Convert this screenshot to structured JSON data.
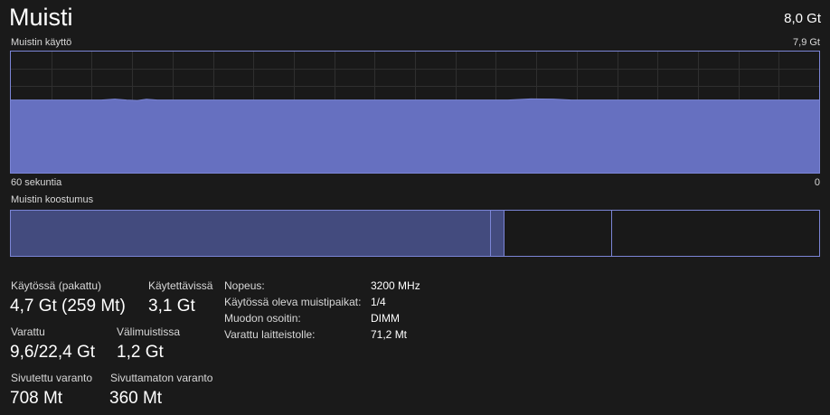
{
  "header": {
    "title": "Muisti",
    "total": "8,0 Gt"
  },
  "usage_graph": {
    "label": "Muistin käyttö",
    "max_label": "7,9 Gt",
    "time_label": "60 sekuntia",
    "zero_label": "0",
    "usage_fraction": 0.6,
    "line_color": "#7b85d6",
    "fill_color": "#6670c0",
    "grid_color": "#2f2f2f"
  },
  "composition": {
    "label": "Muistin koostumus",
    "fill_color": "#434b7e",
    "border_color": "#7b85d6"
  },
  "stats": {
    "in_use_label": "Käytössä (pakattu)",
    "in_use_value": "4,7 Gt (259 Mt)",
    "available_label": "Käytettävissä",
    "available_value": "3,1 Gt",
    "committed_label": "Varattu",
    "committed_value": "9,6/22,4 Gt",
    "cached_label": "Välimuistissa",
    "cached_value": "1,2 Gt",
    "paged_pool_label": "Sivutettu varanto",
    "paged_pool_value": "708 Mt",
    "nonpaged_pool_label": "Sivuttamaton varanto",
    "nonpaged_pool_value": "360 Mt"
  },
  "details": [
    {
      "label": "Nopeus:",
      "value": "3200 MHz"
    },
    {
      "label": "Käytössä oleva muistipaikat:",
      "value": "1/4"
    },
    {
      "label": "Muodon osoitin:",
      "value": "DIMM"
    },
    {
      "label": "Varattu laitteistolle:",
      "value": "71,2 Mt"
    }
  ]
}
